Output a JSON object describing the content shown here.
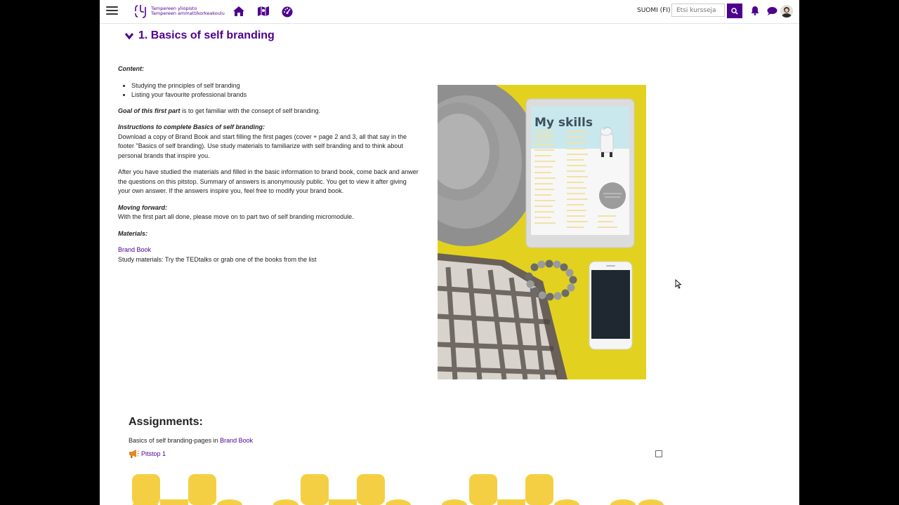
{
  "topbar": {
    "logo_line1": "Tampereen yliopisto",
    "logo_line2": "Tampereen ammattikorkeakoulu",
    "language": "SUOMI (FI)",
    "search_placeholder": "Etsi kursseja",
    "icons": [
      "menu-icon",
      "home-icon",
      "map-book-icon",
      "dashboard-icon",
      "search-icon",
      "bell-icon",
      "chat-icon"
    ],
    "brand_color": "#4e008e"
  },
  "section": {
    "title": "1. Basics of self branding"
  },
  "content": {
    "content_label": "Content:",
    "bullets": [
      "Studying the principles of self branding",
      "Listing your favourite professional brands"
    ],
    "goal_label": "Goal of this first part",
    "goal_text": " is to get familiar with the consept of self branding.",
    "instructions_label": "Instructions to complete Basics of self branding:",
    "instructions_text": "Download a copy of Brand Book and start filling the first pages (cover + page 2 and 3, all that say in the footer \"Basics of self branding). Use study materials to familiarize with self branding and to think about personal brands that inspire you.",
    "after_text": "After you have studied the materials and filled in the basic information to brand book, come back and anwer the questions on this pitstop. Summary of answers is anonymously public. You get to view it after giving your own answer. If the answers inspire you, feel free to modify your brand book.",
    "moving_label": "Moving forward:",
    "moving_text": "With the first part all done, please move on to part two of self branding micromodule.",
    "materials_label": "Materials:",
    "brand_book_link": "Brand Book",
    "study_materials": "Study materials: Try the TEDtalks or grab one of the books from the list"
  },
  "image": {
    "tablet_heading": "My skills",
    "background_color": "#e2d21f"
  },
  "assignments": {
    "title": "Assignments:",
    "line_prefix": "Basics of self branding-pages in ",
    "line_link": "Brand Book",
    "pitstop_label": "Pitstop 1"
  }
}
